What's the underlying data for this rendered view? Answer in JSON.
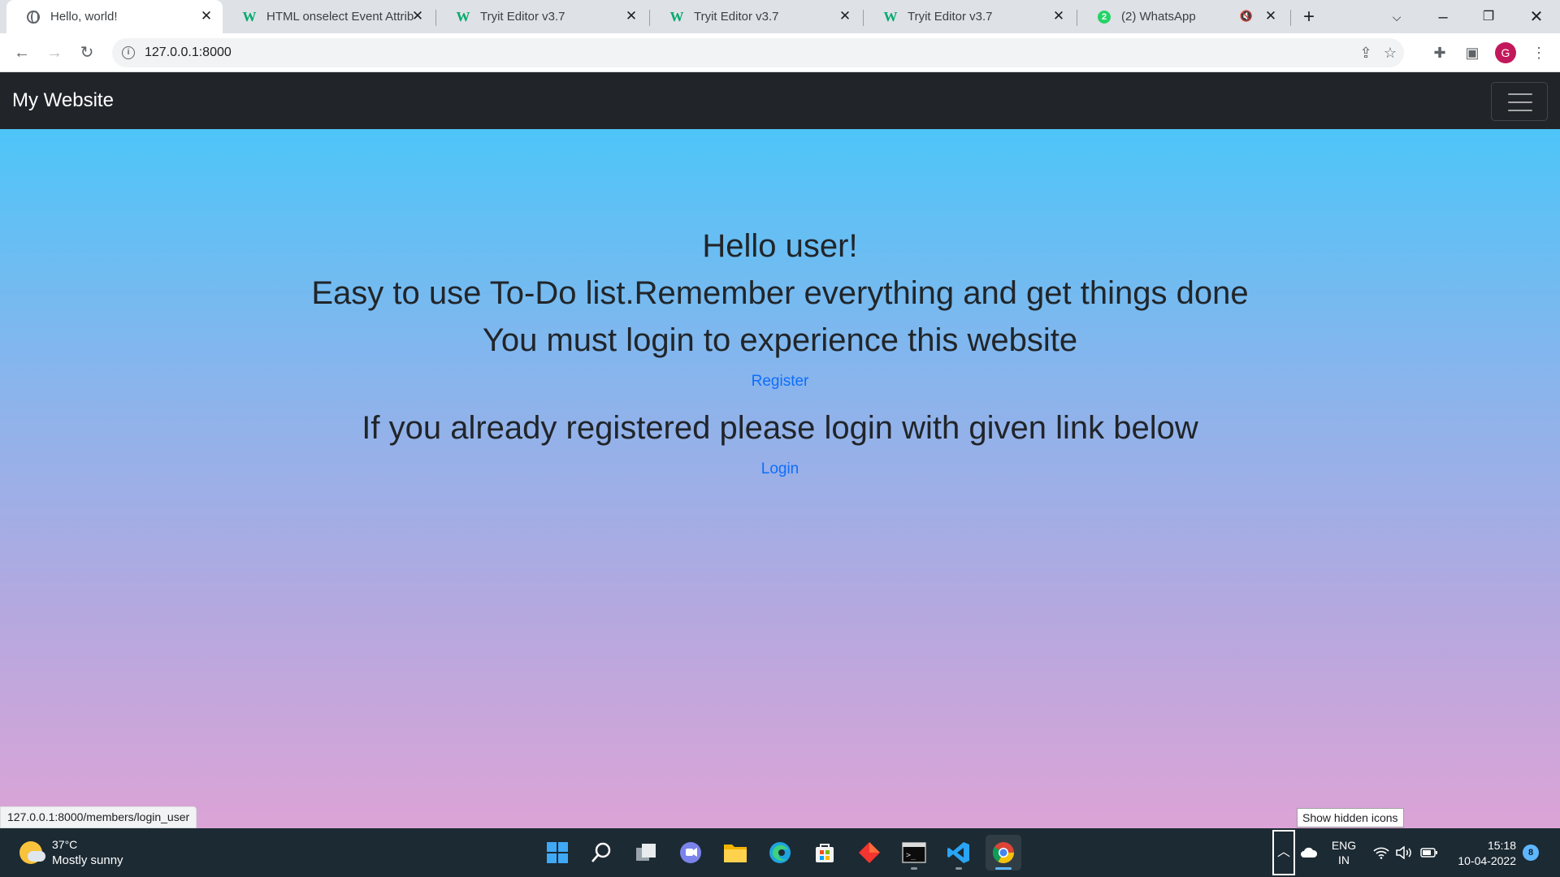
{
  "browser": {
    "tabs": [
      {
        "title": "Hello, world!",
        "icon": "globe-icon",
        "active": true
      },
      {
        "title": "HTML onselect Event Attrib",
        "icon": "w3schools-icon",
        "active": false
      },
      {
        "title": "Tryit Editor v3.7",
        "icon": "w3schools-icon",
        "active": false
      },
      {
        "title": "Tryit Editor v3.7",
        "icon": "w3schools-icon",
        "active": false
      },
      {
        "title": "Tryit Editor v3.7",
        "icon": "w3schools-icon",
        "active": false
      },
      {
        "title": "(2) WhatsApp",
        "icon": "whatsapp-icon",
        "badge": "2",
        "muted": true,
        "active": false
      }
    ],
    "w3_logo_text": "W",
    "url": "127.0.0.1:8000",
    "profile_initial": "G",
    "status_url": "127.0.0.1:8000/members/login_user"
  },
  "page": {
    "brand": "My Website",
    "greeting": "Hello user!",
    "tagline": "Easy to use To-Do list.Remember everything and get things done",
    "login_prompt": "You must login to experience this website",
    "register_link": "Register",
    "already_registered": "If you already registered please login with given link below",
    "login_link": "Login",
    "colors": {
      "navbar": "#212529",
      "gradient_top": "#40c9fb",
      "gradient_bottom": "#dca4d6",
      "link": "#0d6efd"
    }
  },
  "taskbar": {
    "weather_temp": "37°C",
    "weather_condition": "Mostly sunny",
    "tooltip": "Show hidden icons",
    "lang_top": "ENG",
    "lang_bottom": "IN",
    "time": "15:18",
    "date": "10-04-2022",
    "notification_count": "8",
    "apps": [
      "windows-start-icon",
      "search-icon",
      "task-view-icon",
      "teams-chat-icon",
      "file-explorer-icon",
      "edge-icon",
      "store-icon",
      "git-icon",
      "terminal-icon",
      "vscode-icon",
      "chrome-icon"
    ]
  }
}
